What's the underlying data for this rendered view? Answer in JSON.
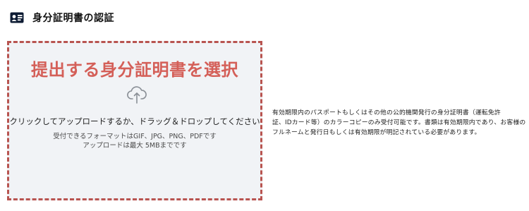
{
  "header": {
    "icon": "id-card-icon",
    "title": "身分証明書の認証"
  },
  "dropzone": {
    "title": "提出する身分証明書を選択",
    "icon": "cloud-upload-icon",
    "instruction": "クリックしてアップロードするか、ドラッグ＆ドロップしてください",
    "formats": "受付できるフォーマットはGIF、JPG、PNG、PDFです",
    "max_size": "アップロードは最大 5MBまでです"
  },
  "notes": {
    "lines": [
      "有効期限内のパスポートもしくはその他の公的機関発行の身分証明書（運転免許",
      "証、IDカード等）のカラーコピーのみ受付可能です。書類は有効期限内であり、お客様の",
      "フルネームと発行日もしくは有効期限が明記されている必要があります。"
    ]
  },
  "colors": {
    "accent": "#d45f58",
    "border": "#b85450",
    "dropzone_bg": "#f1f3f6",
    "icon_dark": "#0d1b33"
  }
}
